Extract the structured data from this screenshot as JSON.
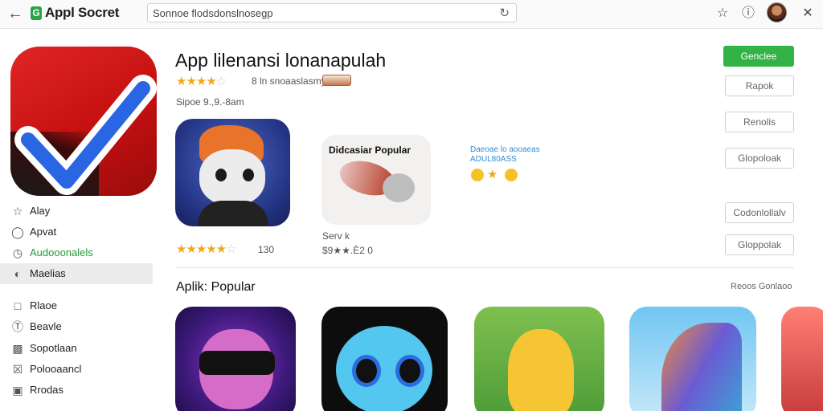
{
  "topbar": {
    "logo_letter": "G",
    "app_title": "Appl Socret",
    "search_value": "Sonnoe flodsdonslnosegp"
  },
  "sidebar": {
    "items": [
      {
        "label": "Alay",
        "icon": "star-outline-icon"
      },
      {
        "label": "Apvat",
        "icon": "compass-icon"
      },
      {
        "label": "Audooonalels",
        "icon": "clock-icon",
        "status": "active"
      },
      {
        "label": "Maelias",
        "icon": "gauge-icon",
        "status": "selected"
      },
      {
        "label": "Rlaoe",
        "icon": "square-icon"
      },
      {
        "label": "Beavle",
        "icon": "dollar-circle-icon"
      },
      {
        "label": "Sopotlaan",
        "icon": "diagonal-box-icon"
      },
      {
        "label": "Polooaancl",
        "icon": "x-box-icon"
      },
      {
        "label": "Rrodas",
        "icon": "image-icon"
      }
    ]
  },
  "app": {
    "name": "App lilenansi lonanapulah",
    "rating_stars": 3.5,
    "rating_text": "8 ln snoaaslasmy",
    "size_text": "Sipoe 9.,9.-8am"
  },
  "actions": {
    "primary": "Genclee",
    "secondary": [
      "Rapok",
      "Renolis",
      "Glopoloak",
      "Codonlollalv",
      "Gloppolak"
    ]
  },
  "screenshots": {
    "shot1_stars": 4.5,
    "shot1_count": "130",
    "shot2_title": "Didcasiar Popular",
    "shot2_sub": "Serv k",
    "shot2_price": "$9★★.È2 0",
    "blue_line1": "Daeoae lo aooaeas",
    "blue_line2": "ADUL80ASS"
  },
  "popular": {
    "title": "Aplik: Popular",
    "link": "Reoos Gonlaoo"
  }
}
